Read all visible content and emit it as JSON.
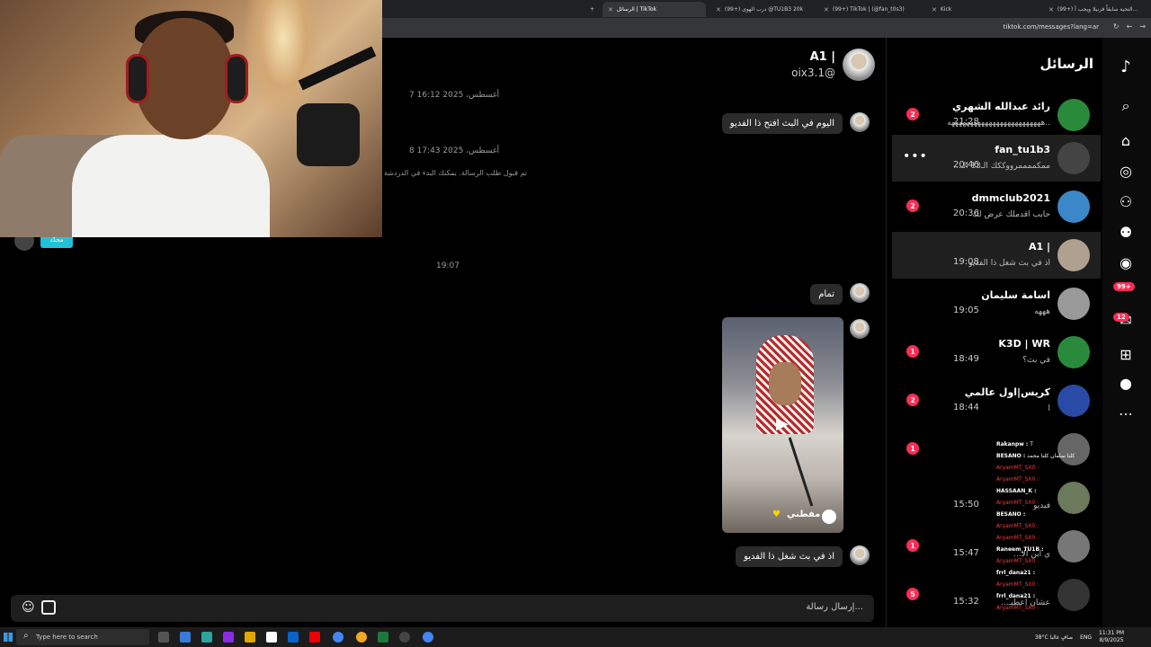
{
  "browser": {
    "tabs": [
      {
        "label": "الرسائل | TikTok",
        "active": true
      },
      {
        "label": "(99+) درب الهوى @TU1B3 20k"
      },
      {
        "label": "(99+) TikTok | (@fan_t0s3)"
      },
      {
        "label": "Kick"
      },
      {
        "label": "(99+) التحية سابقاً فرنيلا ويجب أ..."
      }
    ],
    "url": "tiktok.com/messages?lang=ar"
  },
  "sidebar": {
    "title": "الرسائل",
    "conversations": [
      {
        "name": "رائد عبدالله الشهري",
        "preview": "..هههههههههههههههههههههههههه",
        "time": "21:28",
        "unread": "2",
        "avatar_color": "#2a8a3b"
      },
      {
        "name": "fan_tu1b3",
        "preview": "ممكممممرووككك الـ13 الـ...",
        "time": "20:46",
        "selected": true,
        "more": "•••",
        "avatar_color": "#444"
      },
      {
        "name": "dmmclub2021",
        "preview": "حابب اقدملك عرض لك",
        "time": "20:36",
        "unread": "2",
        "avatar_color": "#3a88c7"
      },
      {
        "name": "A1 |",
        "preview": "اذ في بث شغل ذا الفديو",
        "time": "19:08",
        "selected": true,
        "avatar_color": "#b0a090"
      },
      {
        "name": "اسامة سليمان",
        "preview": "هههه",
        "time": "19:05",
        "avatar_color": "#999"
      },
      {
        "name": "K3D | WR",
        "preview": "في بث؟",
        "time": "18:49",
        "unread": "1",
        "avatar_color": "#2a8a3b"
      },
      {
        "name": "كريس|اول عالمي",
        "preview": "ا",
        "time": "18:44",
        "unread": "2",
        "avatar_color": "#2a4aa8"
      },
      {
        "name": "",
        "preview": "",
        "time": "",
        "unread": "1",
        "avatar_color": "#666"
      },
      {
        "name": "",
        "preview": "فيديو",
        "time": "15:50",
        "avatar_color": "#6a7a5a"
      },
      {
        "name": "",
        "preview": "ي ابن الأ...",
        "time": "15:47",
        "unread": "1",
        "avatar_color": "#777"
      },
      {
        "name": "",
        "preview": "عشان اعطيـ...",
        "time": "15:32",
        "unread": "5",
        "avatar_color": "#333"
      }
    ]
  },
  "rail": {
    "badge_notifications": "99+",
    "badge_inbox": "12"
  },
  "chat": {
    "contact_name": "A1 |",
    "contact_username": "oix3.1@",
    "date1": "7 أغسطس، 2025 16:12",
    "msg1": "اليوم في البث افتح ذا الفديو",
    "date2": "8 أغسطس، 2025 17:43",
    "system_msg": "تم قبول طلب الرسالة. يمكنك البدء في الدردشة",
    "chip_label": "مجدّد",
    "time3": "19:07",
    "msg2": "تمام",
    "video_caption": "مفطني",
    "msg3": "اذ في بث شغل ذا الفديو",
    "composer_placeholder": "إرسال رسالة..."
  },
  "stream_chat": [
    {
      "user": "Rakanpw :",
      "text": "T"
    },
    {
      "user": "BESANO :",
      "text": "كلنا سلمان كلنا محمد"
    },
    {
      "user": "AryamMT_SX0 :",
      "text": ""
    },
    {
      "user": "AryamMT_SX0 :",
      "text": ""
    },
    {
      "user": "HASSAAN_K :",
      "text": ""
    },
    {
      "user": "AryamMT_SX0 :",
      "text": ""
    },
    {
      "user": "BESANO :",
      "text": ""
    },
    {
      "user": "AryamMT_SX0 :",
      "text": ""
    },
    {
      "user": "AryamMT_SX0 :",
      "text": ""
    },
    {
      "user": "Raneem_TU1B :",
      "text": ""
    },
    {
      "user": "AryamMT_SX0 :",
      "text": ""
    },
    {
      "user": "frrl_dana21 :",
      "text": ""
    },
    {
      "user": "AryamMT_SX0 :",
      "text": ""
    },
    {
      "user": "frrl_dana21 :",
      "text": ""
    },
    {
      "user": "AryamMT_SX0 :",
      "text": ""
    }
  ],
  "taskbar": {
    "search_placeholder": "Type here to search",
    "weather": "38°C صافٍ غالبا",
    "lang": "ENG",
    "time": "11:31 PM",
    "date": "8/9/2025"
  }
}
